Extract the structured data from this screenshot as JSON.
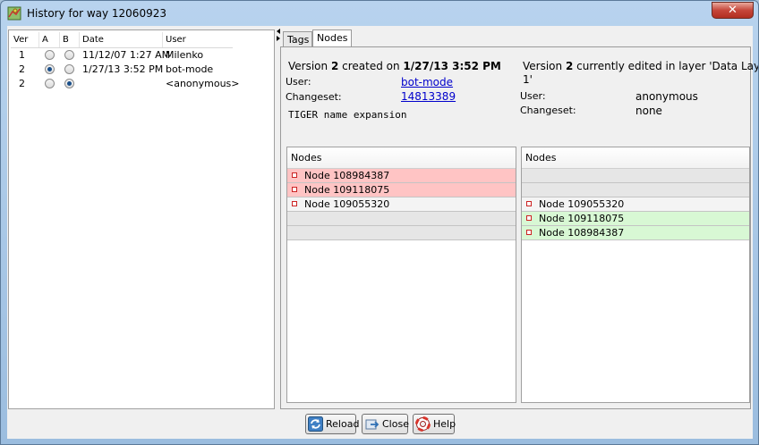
{
  "window": {
    "title": "History for way 12060923",
    "close_label": "✕"
  },
  "versions": {
    "headers": {
      "ver": "Ver",
      "a": "A",
      "b": "B",
      "date": "Date",
      "user": "User"
    },
    "rows": [
      {
        "ver": "1",
        "date": "11/12/07 1:27 AM",
        "user": "Milenko",
        "a": false,
        "b": false
      },
      {
        "ver": "2",
        "date": "1/27/13 3:52 PM",
        "user": "bot-mode",
        "a": true,
        "b": false
      },
      {
        "ver": "2",
        "date": "",
        "user": "<anonymous>",
        "a": false,
        "b": true
      }
    ]
  },
  "tabs": [
    {
      "label": "Tags",
      "active": false
    },
    {
      "label": "Nodes",
      "active": true
    }
  ],
  "left_version": {
    "prefix": "Version ",
    "number": "2",
    "middle": " created on ",
    "date": "1/27/13 3:52 PM",
    "user_label": "User:",
    "user": "bot-mode",
    "changeset_label": "Changeset:",
    "changeset": "14813389",
    "comment": "TIGER name expansion"
  },
  "right_version": {
    "prefix": "Version ",
    "number": "2",
    "suffix": " currently edited in layer 'Data Layer",
    "suffix2": "1'",
    "user_label": "User:",
    "user": "anonymous",
    "changeset_label": "Changeset:",
    "changeset": "none"
  },
  "left_nodes": {
    "header": "Nodes",
    "rows": [
      {
        "label": "Node 108984387",
        "state": "del"
      },
      {
        "label": "Node 109118075",
        "state": "del"
      },
      {
        "label": "Node 109055320",
        "state": "same"
      },
      {
        "label": "",
        "state": "empty"
      },
      {
        "label": "",
        "state": "empty"
      }
    ]
  },
  "right_nodes": {
    "header": "Nodes",
    "rows": [
      {
        "label": "",
        "state": "empty"
      },
      {
        "label": "",
        "state": "empty"
      },
      {
        "label": "Node 109055320",
        "state": "same"
      },
      {
        "label": "Node 109118075",
        "state": "add"
      },
      {
        "label": "Node 108984387",
        "state": "add"
      }
    ]
  },
  "buttons": {
    "reload": "Reload",
    "close": "Close",
    "help": "Help"
  },
  "colors": {
    "deleted": "#ffc4c4",
    "added": "#d8f8d4",
    "link": "#0000cc"
  },
  "icons": {
    "title": "map-icon",
    "reload": "reload-icon",
    "close": "close-icon",
    "help": "help-lifebuoy-icon"
  }
}
